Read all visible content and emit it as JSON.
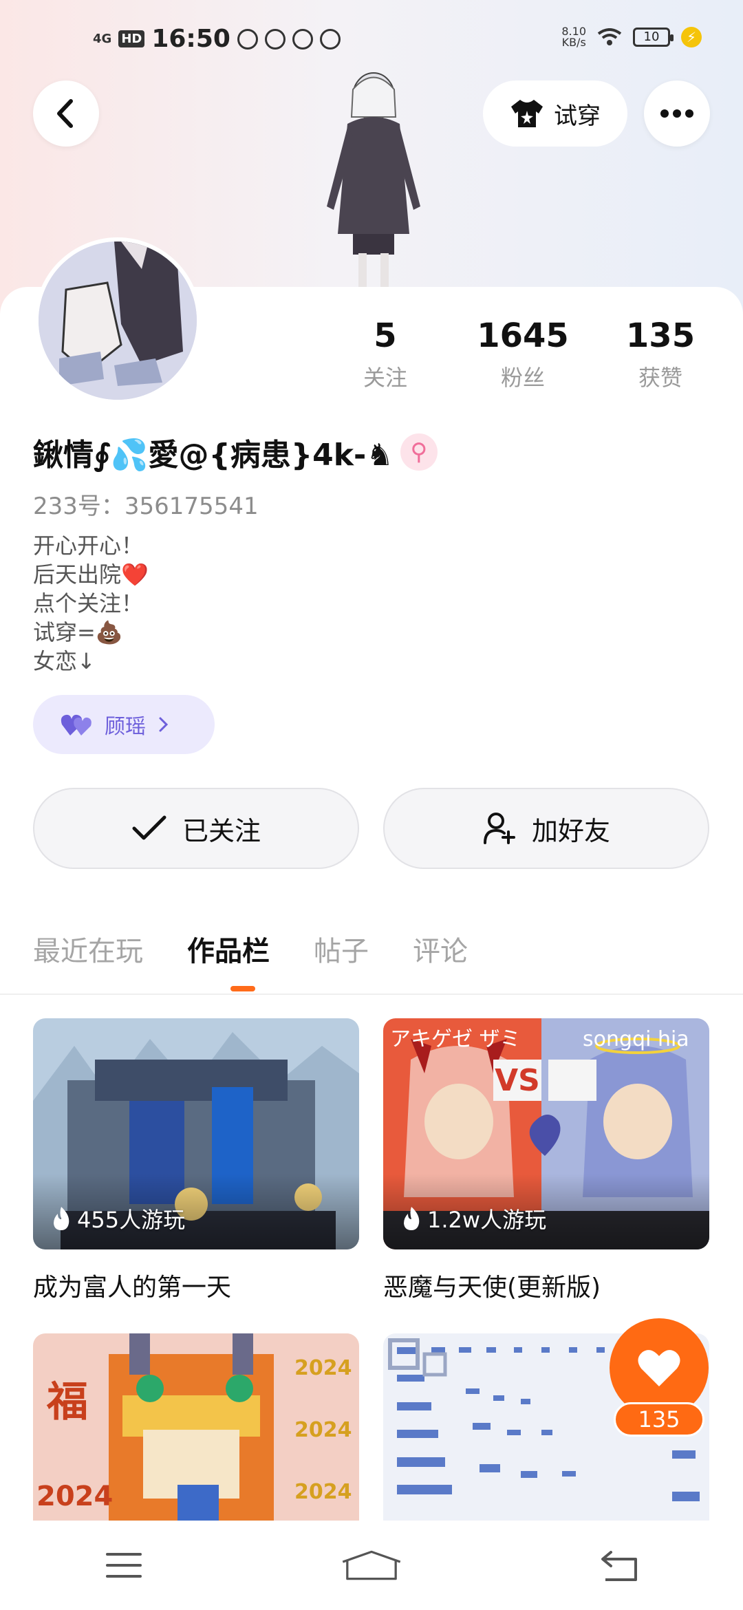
{
  "status_bar": {
    "network": "4G",
    "hd": "HD",
    "time": "16:50",
    "speed_value": "8.10",
    "speed_unit": "KB/s",
    "battery": "10"
  },
  "header": {
    "tryon_label": "试穿"
  },
  "profile": {
    "stats": [
      {
        "value": "5",
        "label": "关注"
      },
      {
        "value": "1645",
        "label": "粉丝"
      },
      {
        "value": "135",
        "label": "获赞"
      }
    ],
    "nickname": "鍬情∮💦愛@{病患}4k-♞",
    "gender_symbol": "⚲",
    "uid": "233号：356175541",
    "bio": [
      "开心开心！",
      "后天出院❤️",
      "点个关注！",
      "试穿=💩",
      "女恋↓"
    ],
    "fan_tag_label": "顾瑶"
  },
  "actions": {
    "follow_label": "已关注",
    "add_friend_label": "加好友"
  },
  "tabs": [
    "最近在玩",
    "作品栏",
    "帖子",
    "评论"
  ],
  "active_tab": "作品栏",
  "works": [
    {
      "plays": "455人游玩",
      "title": "成为富人的第一天"
    },
    {
      "plays": "1.2w人游玩",
      "title": "恶魔与天使(更新版)"
    },
    {
      "plays": "",
      "title": ""
    },
    {
      "plays": "",
      "title": ""
    }
  ],
  "thumb_text": {
    "vs": "VS",
    "katakana": "アキゲゼ ザミ",
    "songq": "songqi hia",
    "fu": "福",
    "year": "2024"
  },
  "like_fab": {
    "count": "135"
  },
  "colors": {
    "accent": "#ff6a13",
    "fan_tag_bg": "#eceafd",
    "fan_tag_text": "#6d5fdb"
  }
}
